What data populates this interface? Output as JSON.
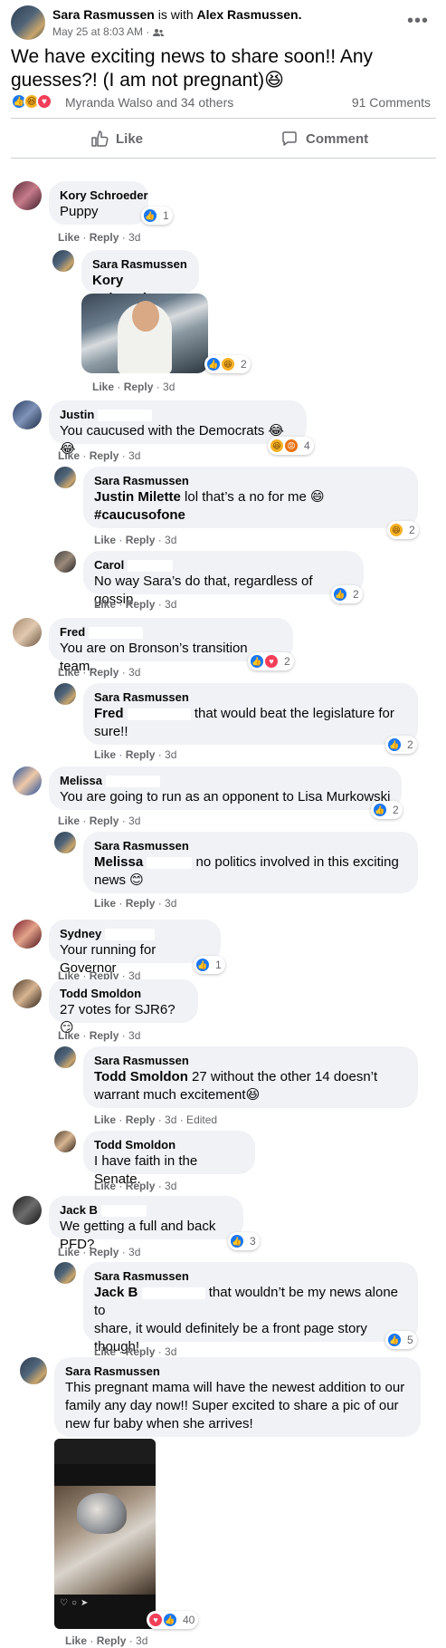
{
  "post": {
    "author": "Sara Rasmussen",
    "with_text": "is with",
    "with_name": "Alex Rasmussen.",
    "timestamp": "May 25 at 8:03 AM · ",
    "privacy_icon": "friends-icon",
    "more_icon": "•••",
    "text": "We have exciting news to share soon!! Any guesses?! (I am not pregnant)😆",
    "reactions_text": "Myranda Walso and 34 others",
    "comments_count": "91 Comments",
    "like_label": "Like",
    "comment_label": "Comment"
  },
  "ui": {
    "like": "Like",
    "reply": "Reply",
    "dot": " · ",
    "age": "3d",
    "edited": "3d · Edited"
  },
  "comments": [
    {
      "name": "Kory Schroeder",
      "text": "Puppy",
      "reactions": "1"
    },
    {
      "name": "Sara Rasmussen",
      "mention": "Kory Schroeder",
      "reactions": "2"
    },
    {
      "name": "Justin",
      "text": "You caucused with the Democrats 😂😂",
      "reactions": "4"
    },
    {
      "name": "Sara Rasmussen",
      "mention": "Justin Milette",
      "text": " lol that’s a no for me 😄",
      "tag": "#caucusofone",
      "reactions": "2"
    },
    {
      "name": "Carol",
      "text": "No way Sara’s do that, regardless of gossip.",
      "reactions": "2"
    },
    {
      "name": "Fred",
      "text": "You are on Bronson’s transition team.",
      "reactions": "2"
    },
    {
      "name": "Sara Rasmussen",
      "mention": "Fred",
      "text": "that would beat the legislature for",
      "text2": "sure!!",
      "reactions": "2"
    },
    {
      "name": "Melissa",
      "text": "You are going to run as an opponent to Lisa Murkowski",
      "reactions": "2"
    },
    {
      "name": "Sara Rasmussen",
      "mention": "Melissa",
      "text": "no politics involved in this exciting",
      "text2": "news 😊"
    },
    {
      "name": "Sydney",
      "text": "Your running for Governor",
      "reactions": "1"
    },
    {
      "name": "Todd Smoldon",
      "text": "27 votes for SJR6? 😏"
    },
    {
      "name": "Sara Rasmussen",
      "mention": "Todd Smoldon",
      "text": " 27 without the other 14 doesn’t",
      "text2": "warrant much excitement😆"
    },
    {
      "name": "Todd Smoldon",
      "text": "I have faith in the Senate."
    },
    {
      "name": "Jack B",
      "text": "We getting a full and back PFD?",
      "reactions": "3"
    },
    {
      "name": "Sara Rasmussen",
      "mention": "Jack B",
      "text": "that wouldn’t be my news alone to",
      "text2": "share, it would definitely be a front page story",
      "text3": "though!",
      "reactions": "5"
    },
    {
      "name": "Sara Rasmussen",
      "text": "This pregnant mama will have the newest addition to our",
      "text2": "family any day now!! Super excited to share a pic of our",
      "text3": "new fur baby when she arrives!",
      "reactions": "40"
    }
  ],
  "colors": {
    "like_blue": "#1877f2",
    "haha_yellow": "#f7b125",
    "love_red": "#f33e58",
    "angry_orange": "#e9710f",
    "bubble": "#f0f2f5"
  }
}
